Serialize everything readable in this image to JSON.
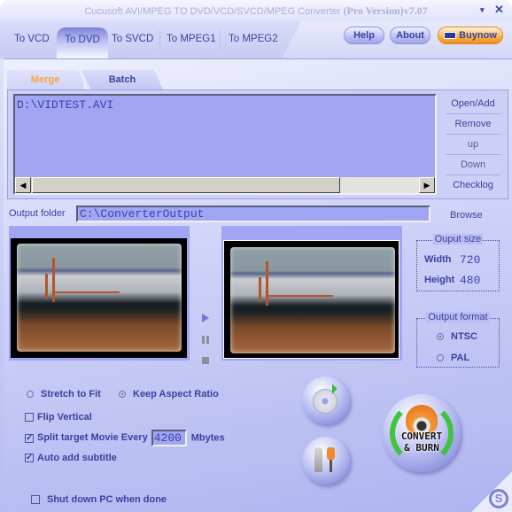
{
  "window": {
    "title_prefix": "Cucusoft AVI/MPEG TO DVD/VCD/SVCD/MPEG Converter ",
    "title_edition": "(Pro Version)",
    "title_version": "v7.07",
    "minimize_glyph": "▾",
    "close_glyph": "✕"
  },
  "tabs": [
    {
      "label": "To VCD",
      "active": false
    },
    {
      "label": "To DVD",
      "active": true
    },
    {
      "label": "To SVCD",
      "active": false
    },
    {
      "label": "To MPEG1",
      "active": false
    },
    {
      "label": "To MPEG2",
      "active": false
    }
  ],
  "header_buttons": {
    "help": "Help",
    "about": "About",
    "buy": "Buynow",
    "buy_icon": "visa-card-icon"
  },
  "subtabs": {
    "merge": "Merge",
    "batch": "Batch",
    "active": "Merge",
    "active_color": "#f5a63a"
  },
  "file_list": {
    "items": [
      "D:\\VIDTEST.AVI"
    ],
    "scroll_left": "◀",
    "scroll_right": "▶"
  },
  "side_buttons": {
    "open_add": "Open/Add",
    "remove": "Remove",
    "up": "up",
    "down": "Down",
    "checklog": "Checklog"
  },
  "output": {
    "label": "Output folder",
    "value": "C:\\ConverterOutput",
    "browse": "Browse"
  },
  "player_controls": {
    "play": "play-icon",
    "pause": "pause-icon",
    "stop": "stop-icon"
  },
  "output_size": {
    "title": "Ouput size",
    "width_label": "Width",
    "width_value": "720",
    "height_label": "Height",
    "height_value": "480"
  },
  "output_format": {
    "title": "Output format",
    "options": [
      {
        "label": "NTSC",
        "selected": true
      },
      {
        "label": "PAL",
        "selected": false
      }
    ]
  },
  "scaling": {
    "options": [
      {
        "label": "Stretch to Fit",
        "selected": false
      },
      {
        "label": "Keep Aspect Ratio",
        "selected": true
      }
    ]
  },
  "options": {
    "flip_vertical": {
      "label": "Flip Vertical",
      "checked": false
    },
    "split": {
      "label": "Split target Movie Every",
      "checked": true,
      "value": "4200",
      "unit": "Mbytes"
    },
    "auto_subtitle": {
      "label": "Auto add subtitle",
      "checked": true
    },
    "shutdown": {
      "label": "Shut down PC when done",
      "checked": false
    }
  },
  "actions": {
    "import_disc": "disc-import-icon",
    "tools": "tools-icon",
    "convert_line1": "CONVERT",
    "convert_line2": "& BURN",
    "corner_logo": "S"
  },
  "colors": {
    "accent": "#3a40a0",
    "field_bg": "#a1a5f4",
    "buy_orange": "#f8b24a"
  }
}
